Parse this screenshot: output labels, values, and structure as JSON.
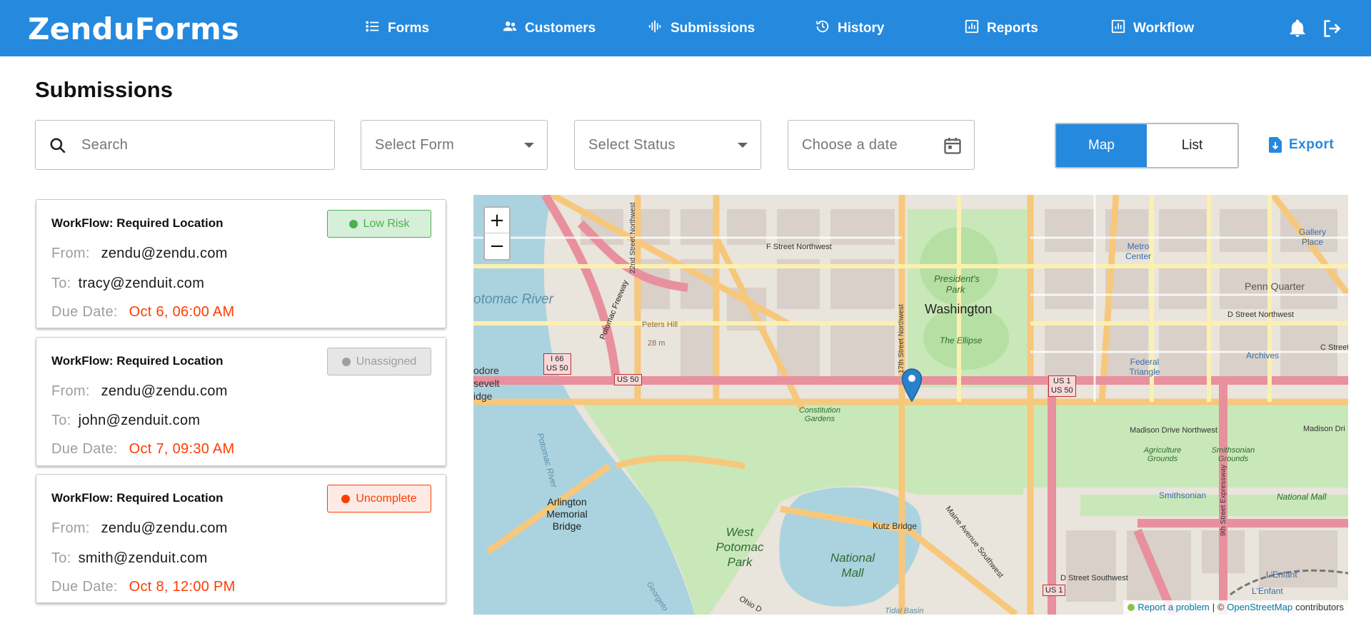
{
  "app": {
    "brand": "ZenduForms"
  },
  "nav": {
    "forms": "Forms",
    "customers": "Customers",
    "submissions": "Submissions",
    "history": "History",
    "reports": "Reports",
    "workflow": "Workflow"
  },
  "page": {
    "title": "Submissions"
  },
  "filters": {
    "search_placeholder": "Search",
    "form_placeholder": "Select Form",
    "status_placeholder": "Select Status",
    "date_placeholder": "Choose a date"
  },
  "view_toggle": {
    "map": "Map",
    "list": "List",
    "selected": "Map"
  },
  "export_label": "Export",
  "submissions": [
    {
      "title": "WorkFlow: Required Location",
      "status": "Low Risk",
      "from_label": "From:",
      "from": "zendu@zendu.com",
      "to_label": "To:",
      "to": "tracy@zenduit.com",
      "due_label": "Due Date:",
      "due": "Oct 6, 06:00 AM"
    },
    {
      "title": "WorkFlow: Required Location",
      "status": "Unassigned",
      "from_label": "From:",
      "from": "zendu@zendu.com",
      "to_label": "To:",
      "to": "john@zenduit.com",
      "due_label": "Due Date:",
      "due": "Oct 7, 09:30 AM"
    },
    {
      "title": "WorkFlow: Required Location",
      "status": "Uncomplete",
      "from_label": "From:",
      "from": "zendu@zendu.com",
      "to_label": "To:",
      "to": "smith@zenduit.com",
      "due_label": "Due Date:",
      "due": "Oct 8, 12:00 PM"
    }
  ],
  "map": {
    "zoom_in": "+",
    "zoom_out": "−",
    "attribution": {
      "report": "Report a problem",
      "sep": "| ©",
      "osm": "OpenStreetMap",
      "suffix": "contributors"
    },
    "labels": {
      "potomac_river": "otomac River",
      "washington": "Washington",
      "presidents_park": "President's Park",
      "the_ellipse": "The Ellipse",
      "f_street": "F Street Northwest",
      "street_22": "22nd Street Northwest",
      "street_17": "17th Street Northwest",
      "peters_hill": "Peters Hill",
      "peters_hill_elev": "28 m",
      "potomac_fwy": "Potomac Freeway",
      "i66": "I 66",
      "us50a": "US 50",
      "us50b": "US 50",
      "us1": "US 1",
      "us1_us50": "US 50",
      "us1b": "US 1",
      "roosevelt_1": "odore",
      "roosevelt_2": "sevelt",
      "roosevelt_3": "idge",
      "constitution_gardens": "Constitution Gardens",
      "arlington_bridge": "Arlington Memorial Bridge",
      "potomac_river_2": "Potomac River",
      "west_potomac_park": "West Potomac Park",
      "kutz_bridge": "Kutz Bridge",
      "national_mall": "National Mall",
      "national_mall_2": "National Mall",
      "maine_ave": "Maine Avenue Southwest",
      "metro_center": "Metro Center",
      "gallery_place": "Gallery Place",
      "penn_quarter": "Penn Quarter",
      "d_street_nw": "D Street Northwest",
      "federal_triangle": "Federal Triangle",
      "archives": "Archives",
      "c_street": "C Street",
      "madison_drive": "Madison Drive Northwest",
      "madison_dr": "Madison Dri",
      "agriculture_grounds": "Agriculture Grounds",
      "smithsonian_grounds": "Smithsonian Grounds",
      "smithsonian": "Smithsonian",
      "ninth_street": "9th Street Expressway",
      "d_street_sw": "D Street Southwest",
      "lenfant": "L'Enfant",
      "lenfant_2": "L'Enfant",
      "ohio": "Ohio D",
      "georgetown": "Georgeto",
      "tidal_basin": "Tidal Basin"
    }
  },
  "colors": {
    "brand_blue": "#2589dd",
    "low_risk": "#4caf50",
    "unassigned": "#9e9e9e",
    "uncomplete": "#ff3d00",
    "due_date": "#ff3d00"
  },
  "icons": {
    "forms": "list-icon",
    "customers": "people-icon",
    "submissions": "waveform-icon",
    "history": "history-icon",
    "reports": "bar-chart-icon",
    "workflow": "bar-chart-icon",
    "notifications": "bell-icon",
    "logout": "logout-icon",
    "search": "search-icon",
    "calendar": "calendar-icon",
    "export": "export-icon",
    "map_marker": "map-pin-icon"
  }
}
